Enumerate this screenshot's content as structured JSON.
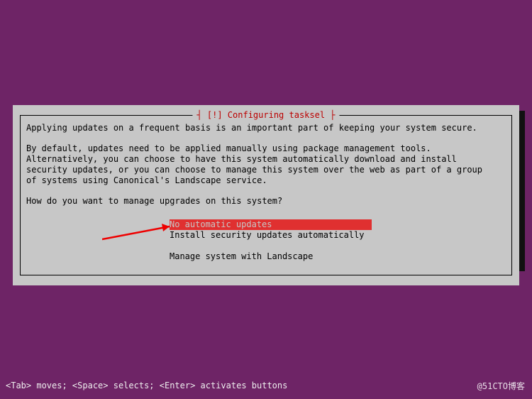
{
  "dialog": {
    "title": "┤ [!] Configuring tasksel ├",
    "paragraph1": "Applying updates on a frequent basis is an important part of keeping your system secure.",
    "paragraph2": "By default, updates need to be applied manually using package management tools.\nAlternatively, you can choose to have this system automatically download and install\nsecurity updates, or you can choose to manage this system over the web as part of a group\nof systems using Canonical's Landscape service.",
    "question": "How do you want to manage upgrades on this system?",
    "options": [
      {
        "label": "No automatic updates",
        "selected": true
      },
      {
        "label": "Install security updates automatically",
        "selected": false
      },
      {
        "label": "Manage system with Landscape",
        "selected": false
      }
    ]
  },
  "status_bar": {
    "text": "<Tab> moves; <Space> selects; <Enter> activates buttons"
  },
  "watermark": {
    "text": "@51CTO博客"
  },
  "annotation": {
    "arrow_color": "#e00"
  }
}
